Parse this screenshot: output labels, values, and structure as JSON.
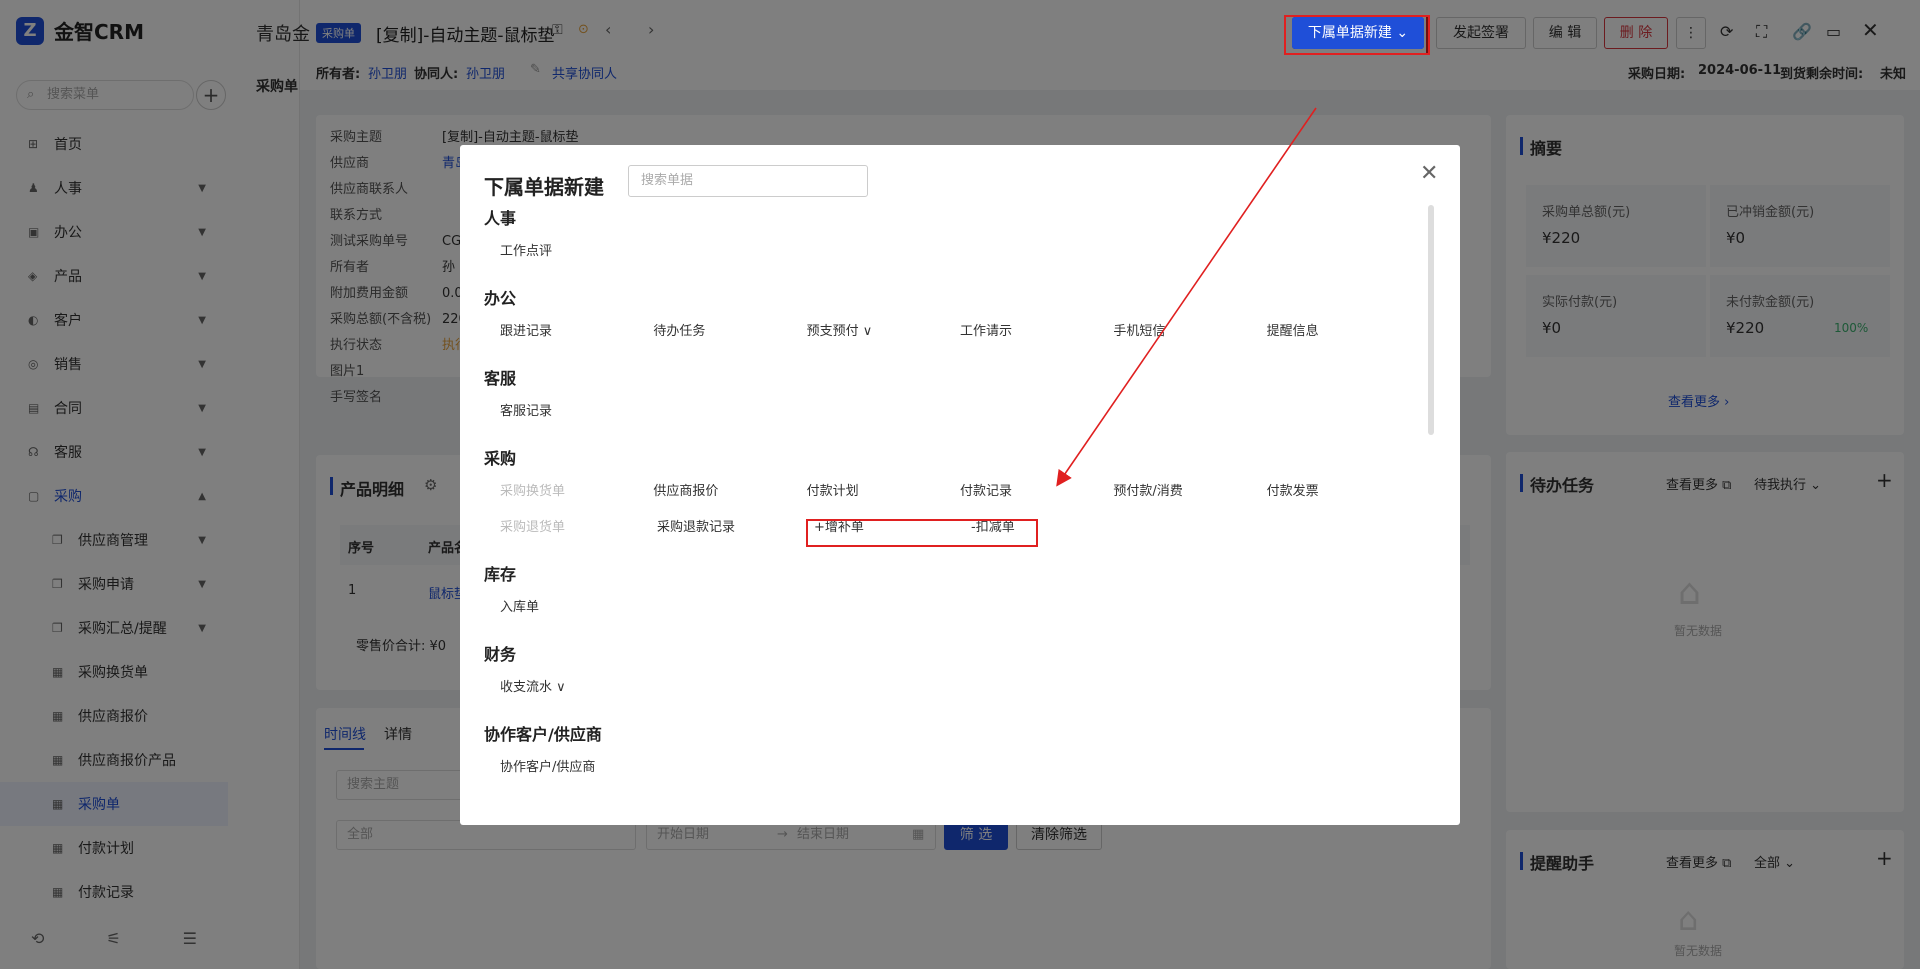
{
  "sidebar": {
    "brand": "金智CRM",
    "search_placeholder": "搜索菜单",
    "items": [
      {
        "label": "首页",
        "icon": "home-icon"
      },
      {
        "label": "人事",
        "icon": "users-icon"
      },
      {
        "label": "办公",
        "icon": "office-icon"
      },
      {
        "label": "产品",
        "icon": "product-icon"
      },
      {
        "label": "客户",
        "icon": "customer-icon"
      },
      {
        "label": "销售",
        "icon": "sales-icon"
      },
      {
        "label": "合同",
        "icon": "contract-icon"
      },
      {
        "label": "客服",
        "icon": "service-icon"
      },
      {
        "label": "采购",
        "icon": "purchase-icon"
      }
    ],
    "sub_items": [
      "供应商管理",
      "采购申请",
      "采购汇总/提醒",
      "采购换货单",
      "供应商报价",
      "供应商报价产品",
      "采购单",
      "付款计划",
      "付款记录"
    ]
  },
  "header": {
    "company": "青岛金",
    "tab": "采购单",
    "badge": "采购单",
    "title": "[复制]-自动主题-鼠标垫",
    "owner_label": "所有者:",
    "owner": "孙卫朋",
    "collab_label": "协同人:",
    "collab": "孙卫朋",
    "share": "共享协同人",
    "date_label": "采购日期:",
    "date": "2024-06-11",
    "remain_label": "到货剩余时间:",
    "remain": "未知",
    "btn_new": "下属单据新建",
    "btn_sign": "发起签署",
    "btn_edit": "编 辑",
    "btn_delete": "删 除"
  },
  "detail": {
    "fields": [
      "采购主题",
      "供应商",
      "供应商联系人",
      "联系方式",
      "测试采购单号",
      "所有者",
      "附加费用金额",
      "采购总额(不含税)",
      "执行状态",
      "图片1",
      "手写签名"
    ],
    "values": [
      "[复制]-自动主题-鼠标垫",
      "青岛",
      "",
      "",
      "CG",
      "孙",
      "0.0",
      "220",
      "执行",
      "",
      ""
    ]
  },
  "product": {
    "title": "产品明细",
    "col_no": "序号",
    "col_name": "产品名",
    "row_no": "1",
    "row_name": "鼠标垫",
    "total": "零售价合计: ¥0"
  },
  "timeline": {
    "tabs": [
      "时间线",
      "详情"
    ],
    "search_placeholder": "搜索主题",
    "filter_all": "全部",
    "start_placeholder": "开始日期",
    "end_placeholder": "结束日期",
    "btn_filter": "筛 选",
    "btn_clear": "清除筛选"
  },
  "summary": {
    "title": "摘要",
    "tiles": [
      {
        "label": "采购单总额(元)",
        "value": "¥220"
      },
      {
        "label": "已冲销金额(元)",
        "value": "¥0"
      },
      {
        "label": "实际付款(元)",
        "value": "¥0"
      },
      {
        "label": "未付款金额(元)",
        "value": "¥220",
        "extra": "100%"
      }
    ],
    "more": "查看更多"
  },
  "todo": {
    "title": "待办任务",
    "more": "查看更多",
    "filter": "待我执行",
    "empty": "暂无数据"
  },
  "reminder": {
    "title": "提醒助手",
    "more": "查看更多",
    "filter": "全部",
    "empty": "暂无数据"
  },
  "modal": {
    "title": "下属单据新建",
    "search_placeholder": "搜索单据",
    "sections": [
      {
        "name": "人事",
        "rows": [
          [
            "工作点评"
          ]
        ]
      },
      {
        "name": "办公",
        "rows": [
          [
            "跟进记录",
            "待办任务",
            "预支预付 ∨",
            "工作请示",
            "手机短信",
            "提醒信息"
          ]
        ]
      },
      {
        "name": "客服",
        "rows": [
          [
            "客服记录"
          ]
        ]
      },
      {
        "name": "采购",
        "rows": [
          [
            "采购换货单",
            "供应商报价",
            "付款计划",
            "付款记录",
            "预付款/消费",
            "付款发票"
          ],
          [
            "采购退货单",
            "采购退款记录",
            "+增补单",
            "-扣减单"
          ]
        ]
      },
      {
        "name": "库存",
        "rows": [
          [
            "入库单"
          ]
        ]
      },
      {
        "name": "财务",
        "rows": [
          [
            "收支流水 ∨"
          ]
        ]
      },
      {
        "name": "协作客户/供应商",
        "rows": [
          [
            "协作客户/供应商"
          ]
        ]
      }
    ]
  },
  "colors": {
    "primary": "#1f4fd8",
    "danger": "#d9363e",
    "annotation": "#e02020"
  }
}
